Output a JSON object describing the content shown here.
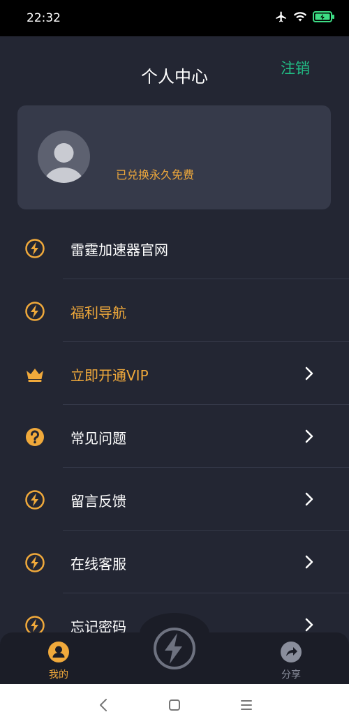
{
  "status_bar": {
    "time": "22:32",
    "icons": [
      "airplane-icon",
      "wifi-icon",
      "battery-charging-icon"
    ]
  },
  "header": {
    "title": "个人中心",
    "logout_label": "注销"
  },
  "profile": {
    "membership_text": "已兑换永久免费"
  },
  "menu": {
    "items": [
      {
        "label": "雷霆加速器官网",
        "icon": "lightning-icon",
        "highlight": false,
        "chevron": false
      },
      {
        "label": "福利导航",
        "icon": "lightning-icon",
        "highlight": true,
        "chevron": false
      },
      {
        "label": "立即开通VIP",
        "icon": "crown-icon",
        "highlight": true,
        "chevron": true
      },
      {
        "label": "常见问题",
        "icon": "question-icon",
        "highlight": false,
        "chevron": true
      },
      {
        "label": "留言反馈",
        "icon": "lightning-icon",
        "highlight": false,
        "chevron": true
      },
      {
        "label": "在线客服",
        "icon": "lightning-icon",
        "highlight": false,
        "chevron": true
      },
      {
        "label": "忘记密码",
        "icon": "lightning-icon",
        "highlight": false,
        "chevron": true
      }
    ]
  },
  "bottom_nav": {
    "tabs": [
      {
        "label": "我的",
        "icon": "user-icon",
        "active": true
      },
      {
        "label": "分享",
        "icon": "share-icon",
        "active": false
      }
    ],
    "center_icon": "lightning-icon"
  },
  "system_nav": {
    "buttons": [
      "back-icon",
      "home-icon",
      "menu-icon"
    ]
  },
  "colors": {
    "background": "#232633",
    "card": "#363a4a",
    "accent_orange": "#f0a93b",
    "accent_green": "#21c187",
    "text": "#ffffff",
    "muted": "#8a8e9c"
  }
}
